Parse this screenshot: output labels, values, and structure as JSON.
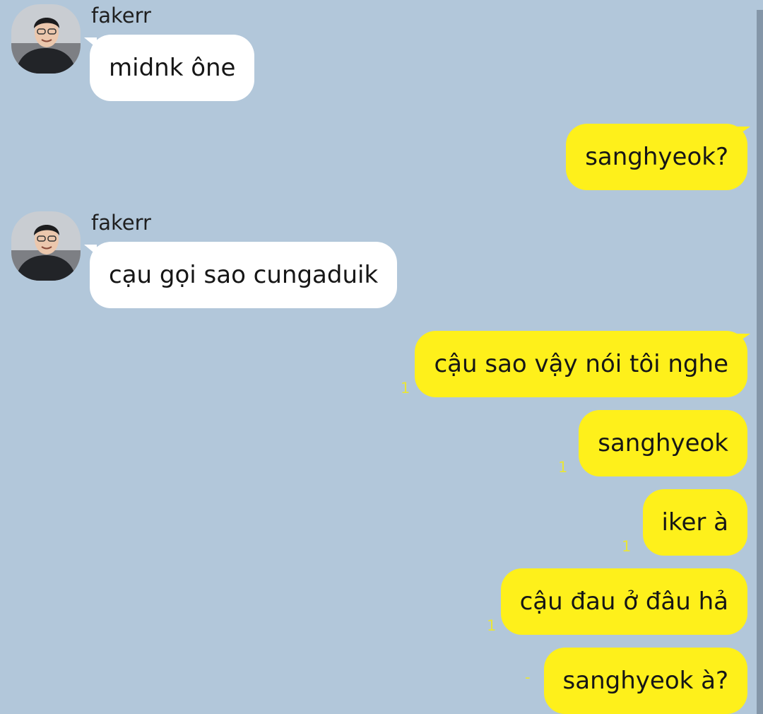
{
  "chat": {
    "messages": [
      {
        "direction": "in",
        "sender": "fakerr",
        "text": "midnk ône"
      },
      {
        "direction": "out",
        "text": "sanghyeok?"
      },
      {
        "direction": "in",
        "sender": "fakerr",
        "text": "cạu gọi sao cungaduik"
      },
      {
        "direction": "out",
        "text": "cậu sao vậy nói tôi nghe",
        "unread": "1"
      },
      {
        "direction": "out",
        "text": "sanghyeok",
        "unread": "1"
      },
      {
        "direction": "out",
        "text": "iker à",
        "unread": "1"
      },
      {
        "direction": "out",
        "text": "cậu đau ở đâu hả",
        "unread": "1"
      },
      {
        "direction": "out",
        "text": "sanghyeok à?",
        "unread": "-"
      }
    ]
  },
  "colors": {
    "background": "#b2c7da",
    "incoming_bubble": "#ffffff",
    "outgoing_bubble": "#fef01b",
    "unread_count": "#e8e53a",
    "scrollbar": "#8496a8"
  },
  "icons": {
    "avatar": "profile-photo-avatar"
  }
}
